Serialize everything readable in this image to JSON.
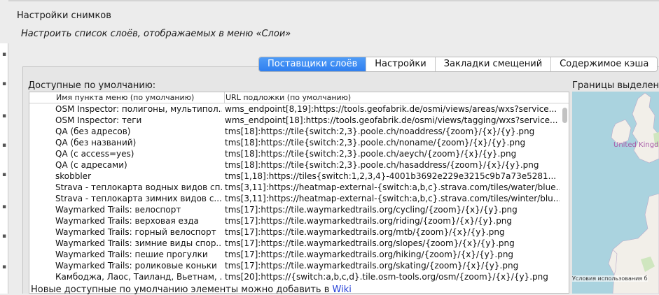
{
  "section": {
    "title": "Настройки снимков",
    "description": "Настроить список слоёв, отображаемых в меню «Слои»"
  },
  "tabs": [
    {
      "label": "Поставщики слоёв",
      "active": true
    },
    {
      "label": "Настройки",
      "active": false
    },
    {
      "label": "Закладки смещений",
      "active": false
    },
    {
      "label": "Содержимое кэша",
      "active": false
    }
  ],
  "available": {
    "label": "Доступные по умолчанию:",
    "columns": [
      "Имя пункта меню (по умолчанию)",
      "URL подложки (по умолчанию)"
    ],
    "rows": [
      {
        "name": "OSM Inspector: полигоны, мультипол...",
        "url": "wms_endpoint[8,19]:https://tools.geofabrik.de/osmi/views/areas/wxs?service..."
      },
      {
        "name": "OSM Inspector: теги",
        "url": "wms_endpoint[18]:https://tools.geofabrik.de/osmi/views/tagging/wxs?service..."
      },
      {
        "name": "QA (без адресов)",
        "url": "tms[18]:https://tile{switch:2,3}.poole.ch/noaddress/{zoom}/{x}/{y}.png"
      },
      {
        "name": "QA (без названий)",
        "url": "tms[18]:https://tile{switch:2,3}.poole.ch/noname/{zoom}/{x}/{y}.png"
      },
      {
        "name": "QA (с access=yes)",
        "url": "tms[18]:https://tile{switch:2,3}.poole.ch/aeych/{zoom}/{x}/{y}.png"
      },
      {
        "name": "QA (с адресами)",
        "url": "tms[18]:https://tile{switch:2,3}.poole.ch/hasaddress/{zoom}/{x}/{y}.png"
      },
      {
        "name": "skobbler",
        "url": "tms[1,18]:https://tiles{switch:1,2,3,4}-4001b3692e229e3215c9b7a73e5281..."
      },
      {
        "name": "Strava - теплокарта водных видов сп...",
        "url": "tms[3,11]:https://heatmap-external-{switch:a,b,c}.strava.com/tiles/water/blue..."
      },
      {
        "name": "Strava - теплокарта зимних видов с...",
        "url": "tms[3,11]:https://heatmap-external-{switch:a,b,c}.strava.com/tiles/winter/blu..."
      },
      {
        "name": "Waymarked Trails: велоспорт",
        "url": "tms[17]:https://tile.waymarkedtrails.org/cycling/{zoom}/{x}/{y}.png"
      },
      {
        "name": "Waymarked Trails: верховая езда",
        "url": "tms[17]:https://tile.waymarkedtrails.org/riding/{zoom}/{x}/{y}.png"
      },
      {
        "name": "Waymarked Trails: горный велоспорт",
        "url": "tms[17]:https://tile.waymarkedtrails.org/mtb/{zoom}/{x}/{y}.png"
      },
      {
        "name": "Waymarked Trails: зимние виды спор...",
        "url": "tms[17]:https://tile.waymarkedtrails.org/slopes/{zoom}/{x}/{y}.png"
      },
      {
        "name": "Waymarked Trails: пешие прогулки",
        "url": "tms[17]:https://tile.waymarkedtrails.org/hiking/{zoom}/{x}/{y}.png"
      },
      {
        "name": "Waymarked Trails: роликовые коньки",
        "url": "tms[17]:https://tile.waymarkedtrails.org/skating/{zoom}/{x}/{y}.png"
      },
      {
        "name": "Камбоджа, Лаос, Таиланд, Вьетнам, ...",
        "url": "tms[20]:https://{switch:a,b,c,d}.tile.osm-tools.org/osm/{zoom}/{x}/{y}.png"
      }
    ]
  },
  "map": {
    "label": "Границы выделенн",
    "country": "United Kingd",
    "attribution": "Условия использования б"
  },
  "footer": {
    "text": "Новые доступные по умолчанию элементы можно добавить в",
    "link": "Wiki"
  },
  "colors": {
    "accent": "#2f7ff0",
    "link": "#2440d6",
    "sea": "#aad3df",
    "land": "#f2efe9"
  }
}
